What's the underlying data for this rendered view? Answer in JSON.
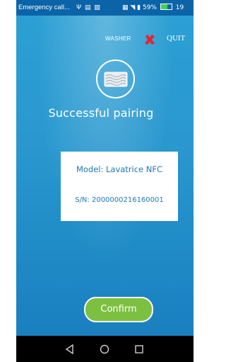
{
  "status_bar": {
    "carrier_text": "Emergency call...",
    "mid_icons": "Ψ ▤ ▧",
    "battery_percent": "59%",
    "time": "19",
    "battery_level": 0.59
  },
  "header": {
    "washer_label": "WASHER",
    "quit_label": "QUIT",
    "accent_red": "#e8232f"
  },
  "main": {
    "title": "Successful pairing",
    "model_text": "Model: Lavatrice NFC",
    "sn_text": "S/N: 2000000216160001"
  },
  "confirm_button": {
    "label": "Confirm",
    "color": "#7cc041"
  },
  "nav_bar": {
    "back": "back-icon",
    "home": "home-icon",
    "recents": "recents-icon"
  }
}
